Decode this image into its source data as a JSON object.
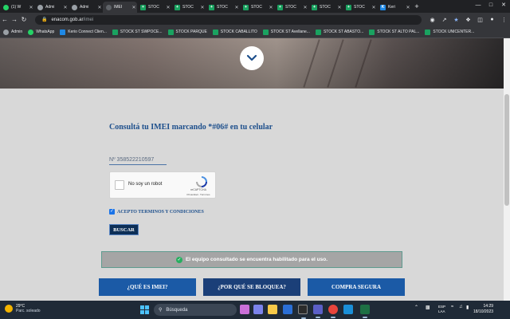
{
  "browser": {
    "tabs": [
      {
        "title": "(1) W",
        "icon": "whatsapp-icon",
        "favclass": "wa",
        "glyph": "",
        "active": false
      },
      {
        "title": "Admi",
        "icon": "globe-icon",
        "favclass": "globe",
        "glyph": "",
        "active": false
      },
      {
        "title": "Admi",
        "icon": "globe-icon",
        "favclass": "globe",
        "glyph": "",
        "active": false
      },
      {
        "title": "IMEI",
        "icon": "site-icon",
        "favclass": "gov",
        "glyph": "",
        "active": true
      },
      {
        "title": "STOC",
        "icon": "sheets-icon",
        "favclass": "sheet",
        "glyph": "+",
        "active": false
      },
      {
        "title": "STOC",
        "icon": "sheets-icon",
        "favclass": "sheet",
        "glyph": "+",
        "active": false
      },
      {
        "title": "STOC",
        "icon": "sheets-icon",
        "favclass": "sheet",
        "glyph": "+",
        "active": false
      },
      {
        "title": "STOC",
        "icon": "sheets-icon",
        "favclass": "sheet",
        "glyph": "+",
        "active": false
      },
      {
        "title": "STOC",
        "icon": "sheets-icon",
        "favclass": "sheet",
        "glyph": "+",
        "active": false
      },
      {
        "title": "STOC",
        "icon": "sheets-icon",
        "favclass": "sheet",
        "glyph": "+",
        "active": false
      },
      {
        "title": "STOC",
        "icon": "sheets-icon",
        "favclass": "sheet",
        "glyph": "+",
        "active": false
      },
      {
        "title": "Keri",
        "icon": "kerio-icon",
        "favclass": "kerio",
        "glyph": "K",
        "active": false
      }
    ],
    "new_tab": "+",
    "url_host": "enacom.gob.ar",
    "url_path": "/imei",
    "bookmarks": [
      {
        "label": "Admin",
        "icon": "globe",
        "name": "admin"
      },
      {
        "label": "WhatsApp",
        "icon": "wa",
        "name": "whatsapp"
      },
      {
        "label": "Kerio Connect Clien...",
        "icon": "kerio",
        "name": "kerio"
      },
      {
        "label": "STOCK ST SWPOCE...",
        "icon": "sheet",
        "name": "stock-swpoce"
      },
      {
        "label": "STOCK PARQUE",
        "icon": "sheet",
        "name": "stock-parque"
      },
      {
        "label": "STOCK CABALLITO",
        "icon": "sheet",
        "name": "stock-caballito"
      },
      {
        "label": "STOCK ST Avellane...",
        "icon": "sheet",
        "name": "stock-avellaneda"
      },
      {
        "label": "STOCK ST ABASTO...",
        "icon": "sheet",
        "name": "stock-abasto"
      },
      {
        "label": "STOCK ST ALTO PAL...",
        "icon": "sheet",
        "name": "stock-alto-palermo"
      },
      {
        "label": "STOCK UNICENTER...",
        "icon": "sheet",
        "name": "stock-unicenter"
      }
    ]
  },
  "page": {
    "heading": "Consultá tu IMEI marcando *#06# en tu celular",
    "imei_value": "Nº 358522210597",
    "captcha_label": "No soy un robot",
    "captcha_brand": "reCAPTCHA",
    "captcha_terms": "Privacidad - Términos",
    "accept_label": "ACEPTO TERMINOS Y CONDICIONES",
    "search_button": "BUSCAR",
    "result_message": "El equipo consultado se encuentra habilitado para el uso.",
    "info_buttons": [
      "¿QUÉ ES IMEI?",
      "¿POR QUÉ SE BLOQUEA?",
      "COMPRA SEGURA"
    ]
  },
  "taskbar": {
    "temp": "29°C",
    "weather": "Parc. soleado",
    "search_placeholder": "Búsqueda",
    "lang1": "ESP",
    "lang2": "LAA",
    "time": "14:29",
    "date": "18/10/2023"
  },
  "colors": {
    "heading": "#1d4f8c",
    "buscar_bg": "#0d2f57",
    "result_bg": "#a5a5a5",
    "info_button": "#1b5aa6",
    "page_bg": "#d8d8d8"
  }
}
